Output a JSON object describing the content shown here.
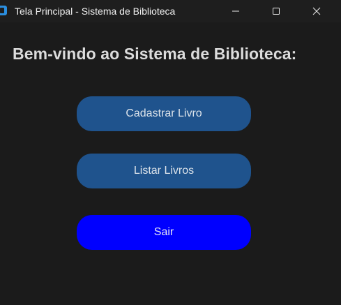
{
  "window": {
    "title": "Tela Principal - Sistema de Biblioteca",
    "icon": "app-window-icon",
    "controls": {
      "minimize_icon": "minimize-icon",
      "maximize_icon": "maximize-icon",
      "close_icon": "close-icon"
    }
  },
  "main": {
    "heading": "Bem-vindo ao Sistema de Biblioteca:",
    "buttons": {
      "register_book": "Cadastrar Livro",
      "list_books": "Listar Livros",
      "exit": "Sair"
    }
  },
  "colors": {
    "background": "#1b1b1b",
    "primary_button": "#1f538d",
    "exit_button": "#0000ff",
    "heading_text": "#dcdcdc"
  }
}
